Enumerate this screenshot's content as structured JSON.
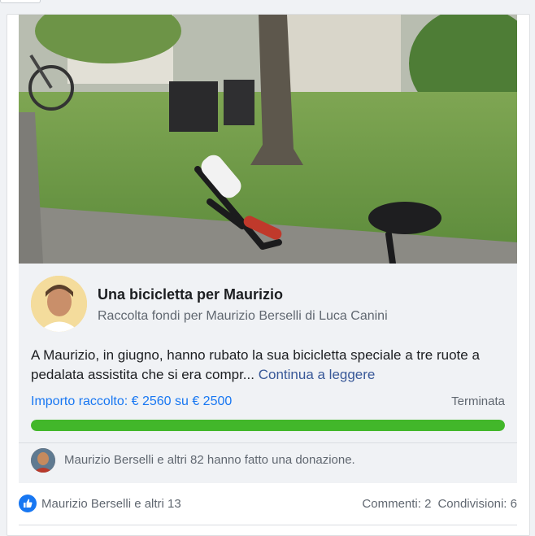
{
  "fundraiser": {
    "title": "Una bicicletta per Maurizio",
    "subtitle": "Raccolta fondi per Maurizio Berselli di Luca Canini",
    "description": "A Maurizio, in giugno, hanno rubato la sua bicicletta speciale a tre ruote a pedalata assistita che si era compr...",
    "continue_label": "Continua a leggere",
    "raised_text": "Importo raccolto: € 2560 su € 2500",
    "status": "Terminata",
    "progress_fraction": 1.0,
    "donations_text": "Maurizio Berselli e altri 82 hanno fatto una donazione."
  },
  "footer": {
    "likes_text": "Maurizio Berselli e altri 13",
    "comments_text": "Commenti: 2",
    "shares_text": "Condivisioni: 6"
  },
  "colors": {
    "progress_fill": "#42b72a",
    "link": "#1877f2",
    "accent": "#385898"
  }
}
